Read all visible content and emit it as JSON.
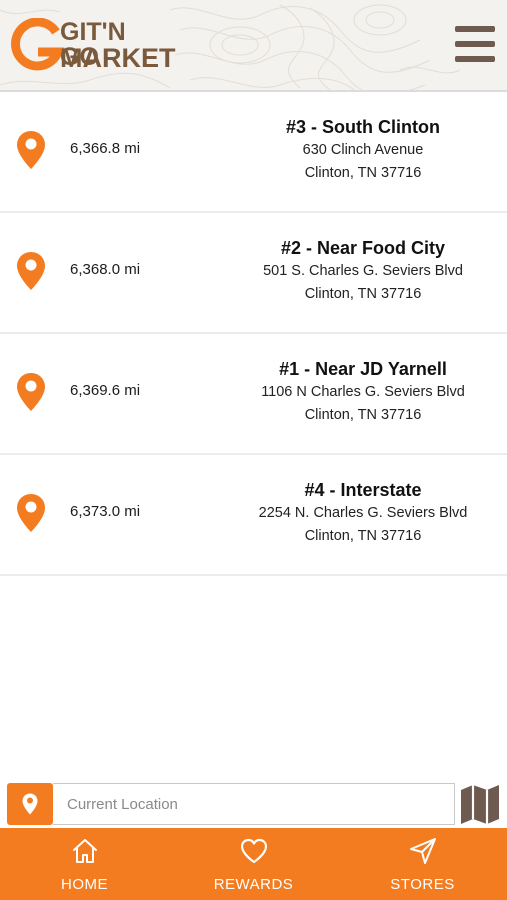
{
  "header": {
    "logo_line1": "GIT'N GO",
    "logo_line2": "MARKET",
    "menu_icon": "hamburger-menu-icon",
    "brand_color": "#f47c20",
    "logo_text_color": "#7a5a3c"
  },
  "stores": [
    {
      "distance": "6,366.8 mi",
      "name": "#3 - South Clinton",
      "address1": "630 Clinch Avenue",
      "address2": "Clinton, TN 37716"
    },
    {
      "distance": "6,368.0 mi",
      "name": "#2 - Near Food City",
      "address1": "501 S. Charles G. Seviers Blvd",
      "address2": "Clinton, TN 37716"
    },
    {
      "distance": "6,369.6 mi",
      "name": "#1 - Near JD Yarnell",
      "address1": "1106 N Charles G. Seviers Blvd",
      "address2": "Clinton, TN 37716"
    },
    {
      "distance": "6,373.0 mi",
      "name": "#4 - Interstate",
      "address1": "2254 N. Charles G. Seviers Blvd",
      "address2": "Clinton, TN 37716"
    }
  ],
  "location_bar": {
    "placeholder": "Current Location",
    "value": "",
    "locate_icon": "location-pin-icon",
    "map_icon": "map-icon"
  },
  "nav": {
    "home_label": "HOME",
    "rewards_label": "REWARDS",
    "stores_label": "STORES"
  }
}
